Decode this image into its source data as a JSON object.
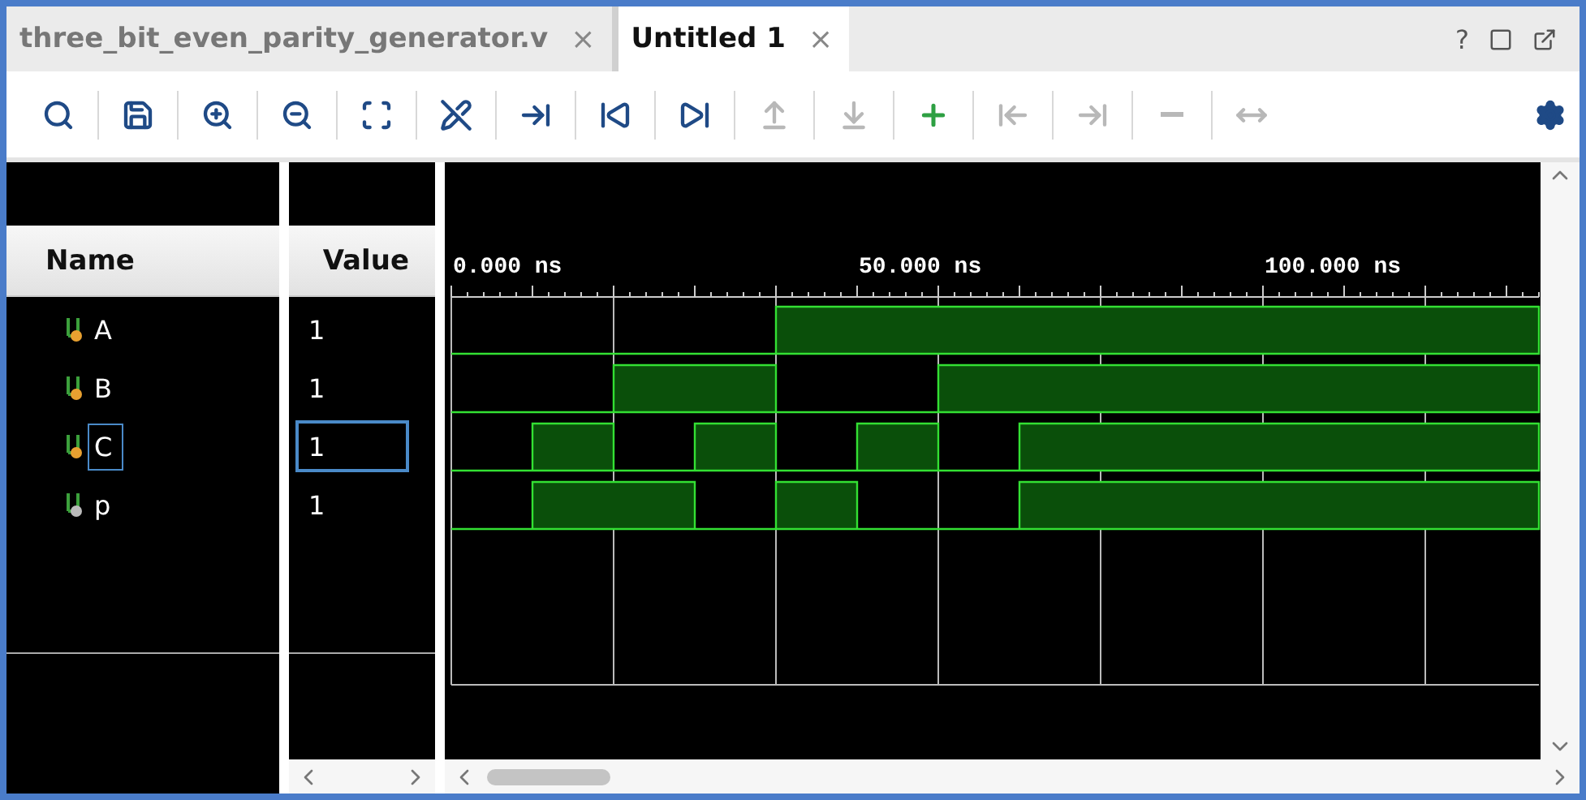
{
  "tabs": [
    {
      "label": "three_bit_even_parity_generator.v",
      "close": "×",
      "selected": false
    },
    {
      "label": "Untitled 1",
      "close": "×",
      "selected": true
    }
  ],
  "window_controls": {
    "help": "?"
  },
  "toolbar": [
    {
      "kind": "search",
      "disabled": false
    },
    {
      "kind": "save",
      "disabled": false
    },
    {
      "kind": "zoom-in",
      "disabled": false
    },
    {
      "kind": "zoom-out",
      "disabled": false
    },
    {
      "kind": "zoom-fit",
      "disabled": false
    },
    {
      "kind": "cursor-off",
      "disabled": false
    },
    {
      "kind": "goto-cursor",
      "disabled": false
    },
    {
      "kind": "goto-start",
      "disabled": false
    },
    {
      "kind": "goto-end",
      "disabled": false
    },
    {
      "kind": "prev-transition",
      "disabled": true
    },
    {
      "kind": "next-transition",
      "disabled": true
    },
    {
      "kind": "add-marker",
      "disabled": false
    },
    {
      "kind": "prev-marker",
      "disabled": true
    },
    {
      "kind": "next-marker",
      "disabled": true
    },
    {
      "kind": "delete-marker",
      "disabled": true
    },
    {
      "kind": "swap-markers",
      "disabled": true
    }
  ],
  "columns": {
    "name": "Name",
    "value": "Value"
  },
  "signals": [
    {
      "name": "A",
      "value": "1",
      "kind": "input",
      "selected": false
    },
    {
      "name": "B",
      "value": "1",
      "kind": "input",
      "selected": false
    },
    {
      "name": "C",
      "value": "1",
      "kind": "input",
      "selected": true
    },
    {
      "name": "p",
      "value": "1",
      "kind": "output",
      "selected": false
    }
  ],
  "timeline": {
    "labels": [
      "0.000 ns",
      "50.000 ns",
      "100.000 ns"
    ]
  }
}
